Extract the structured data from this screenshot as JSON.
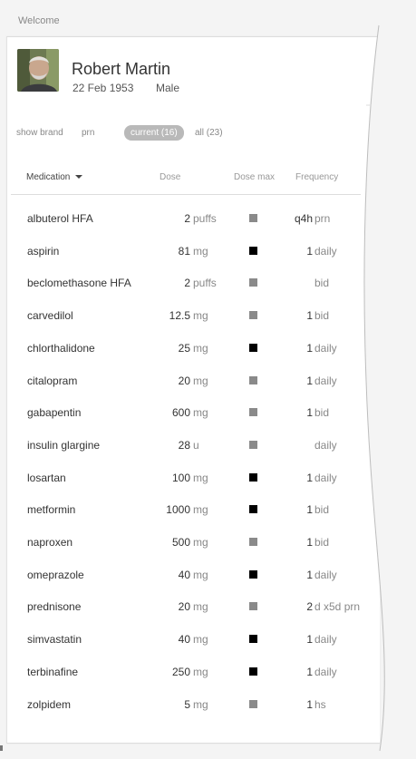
{
  "header": {
    "welcome": "Welcome"
  },
  "patient": {
    "name": "Robert Martin",
    "dob": "22 Feb 1953",
    "sex": "Male"
  },
  "filters": {
    "show_brand": "show brand",
    "prn": "prn",
    "current": "current (16)",
    "all": "all (23)"
  },
  "columns": {
    "medication": "Medication",
    "dose": "Dose",
    "dose_max": "Dose max",
    "frequency": "Frequency"
  },
  "colors": {
    "dark_box": "#000000",
    "light_box": "#8a8a8a",
    "current_pill": "#b9b9b9"
  },
  "medications": [
    {
      "name": "albuterol HFA",
      "dose": "2",
      "unit": "puffs",
      "dose_max": "light",
      "freq_qty": "q4h",
      "freq_desc": "prn"
    },
    {
      "name": "aspirin",
      "dose": "81",
      "unit": "mg",
      "dose_max": "dark",
      "freq_qty": "1",
      "freq_desc": "daily"
    },
    {
      "name": "beclomethasone HFA",
      "dose": "2",
      "unit": "puffs",
      "dose_max": "light",
      "freq_qty": "",
      "freq_desc": "bid"
    },
    {
      "name": "carvedilol",
      "dose": "12.5",
      "unit": "mg",
      "dose_max": "light",
      "freq_qty": "1",
      "freq_desc": "bid"
    },
    {
      "name": "chlorthalidone",
      "dose": "25",
      "unit": "mg",
      "dose_max": "dark",
      "freq_qty": "1",
      "freq_desc": "daily"
    },
    {
      "name": "citalopram",
      "dose": "20",
      "unit": "mg",
      "dose_max": "light",
      "freq_qty": "1",
      "freq_desc": "daily"
    },
    {
      "name": "gabapentin",
      "dose": "600",
      "unit": "mg",
      "dose_max": "light",
      "freq_qty": "1",
      "freq_desc": "bid"
    },
    {
      "name": "insulin glargine",
      "dose": "28",
      "unit": "u",
      "dose_max": "light",
      "freq_qty": "",
      "freq_desc": "daily"
    },
    {
      "name": "losartan",
      "dose": "100",
      "unit": "mg",
      "dose_max": "dark",
      "freq_qty": "1",
      "freq_desc": "daily"
    },
    {
      "name": "metformin",
      "dose": "1000",
      "unit": "mg",
      "dose_max": "dark",
      "freq_qty": "1",
      "freq_desc": "bid"
    },
    {
      "name": "naproxen",
      "dose": "500",
      "unit": "mg",
      "dose_max": "light",
      "freq_qty": "1",
      "freq_desc": "bid"
    },
    {
      "name": "omeprazole",
      "dose": "40",
      "unit": "mg",
      "dose_max": "dark",
      "freq_qty": "1",
      "freq_desc": "daily"
    },
    {
      "name": "prednisone",
      "dose": "20",
      "unit": "mg",
      "dose_max": "light",
      "freq_qty": "2",
      "freq_desc": "d x5d prn"
    },
    {
      "name": "simvastatin",
      "dose": "40",
      "unit": "mg",
      "dose_max": "dark",
      "freq_qty": "1",
      "freq_desc": "daily"
    },
    {
      "name": "terbinafine",
      "dose": "250",
      "unit": "mg",
      "dose_max": "dark",
      "freq_qty": "1",
      "freq_desc": "daily"
    },
    {
      "name": "zolpidem",
      "dose": "5",
      "unit": "mg",
      "dose_max": "light",
      "freq_qty": "1",
      "freq_desc": "hs"
    }
  ]
}
